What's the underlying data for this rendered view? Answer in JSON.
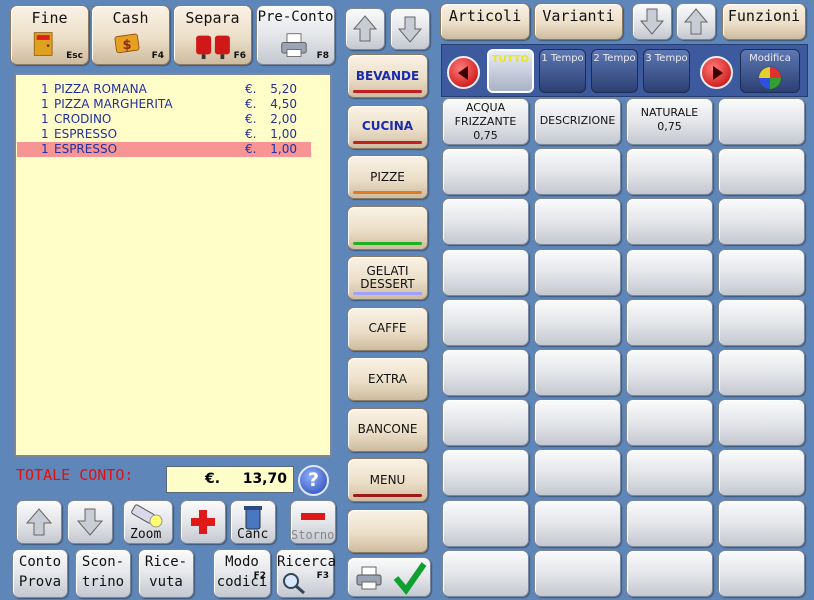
{
  "toolbar": {
    "fine": {
      "label": "Fine",
      "key": "Esc"
    },
    "cash": {
      "label": "Cash",
      "key": "F4"
    },
    "separa": {
      "label": "Separa",
      "key": "F6"
    },
    "preconto": {
      "label": "Pre-Conto",
      "key": "F8"
    }
  },
  "order": {
    "items": [
      {
        "qty": "1",
        "name": "PIZZA ROMANA",
        "currency": "€.",
        "price": "5,20"
      },
      {
        "qty": "1",
        "name": "PIZZA MARGHERITA",
        "currency": "€.",
        "price": "4,50"
      },
      {
        "qty": "1",
        "name": "CRODINO",
        "currency": "€.",
        "price": "2,00"
      },
      {
        "qty": "1",
        "name": "ESPRESSO",
        "currency": "€.",
        "price": "1,00"
      },
      {
        "qty": "1",
        "name": "ESPRESSO",
        "currency": "€.",
        "price": "1,00"
      }
    ],
    "selected_index": 4,
    "total_label": "TOTALE CONTO:",
    "total_currency": "€.",
    "total_value": "13,70",
    "help": "?"
  },
  "controls": {
    "zoom": "Zoom",
    "canc": "Canc",
    "storno": "Storno"
  },
  "bottom": {
    "conto_prova": [
      "Conto",
      "Prova"
    ],
    "scontrino": [
      "Scon-",
      "trino"
    ],
    "ricevuta": [
      "Rice-",
      "vuta"
    ],
    "modo_codici": {
      "lines": [
        "Modo",
        "codici"
      ],
      "key": "F2"
    },
    "ricerca": {
      "lines": [
        "Ricerca"
      ],
      "key": "F3"
    }
  },
  "categories": [
    {
      "label": "BEVANDE",
      "bar": "#c02020"
    },
    {
      "label": "CUCINA",
      "bar": "#c02020"
    },
    {
      "label": "PIZZE",
      "bar": "#e07a20"
    },
    {
      "label": "",
      "bar": "#20b020"
    },
    {
      "label": "GELATI DESSERT",
      "bar": "#a0a0ff"
    },
    {
      "label": "CAFFE",
      "bar": ""
    },
    {
      "label": "EXTRA",
      "bar": ""
    },
    {
      "label": "BANCONE",
      "bar": ""
    },
    {
      "label": "MENU",
      "bar": "#a01818"
    },
    {
      "label": "",
      "bar": ""
    }
  ],
  "tabs": {
    "articoli": "Articoli",
    "varianti": "Varianti",
    "funzioni": "Funzioni"
  },
  "filters": {
    "tutto": "TUTTO",
    "t1": "1 Tempo",
    "t2": "2 Tempo",
    "t3": "3 Tempo",
    "modifica": "Modifica"
  },
  "articles": [
    [
      "ACQUA",
      "FRIZZANTE",
      "0,75"
    ],
    [
      "DESCRIZIONE"
    ],
    [
      "NATURALE",
      "0,75"
    ]
  ]
}
